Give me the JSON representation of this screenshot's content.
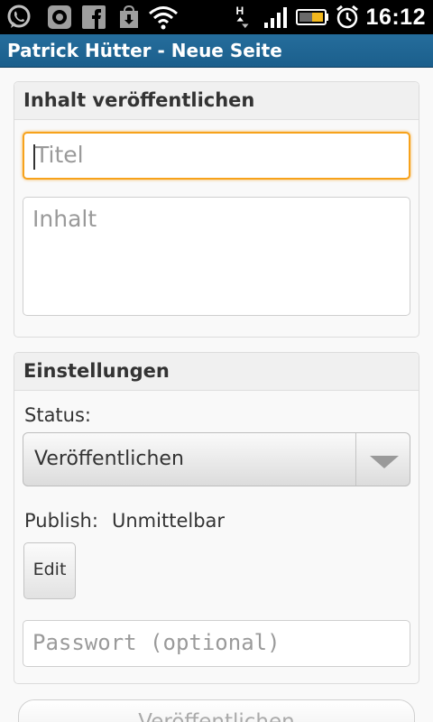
{
  "status_bar": {
    "time": "16:12",
    "icons": [
      "whatsapp-icon",
      "camera-app-icon",
      "facebook-icon",
      "download-icon",
      "wifi-icon",
      "hsdpa-data-icon",
      "signal-icon",
      "battery-icon",
      "alarm-icon"
    ]
  },
  "app_bar": {
    "title": "Patrick Hütter - Neue Seite"
  },
  "content_section": {
    "heading": "Inhalt veröffentlichen",
    "title_placeholder": "Titel",
    "body_placeholder": "Inhalt"
  },
  "settings_section": {
    "heading": "Einstellungen",
    "status_label": "Status:",
    "status_value": "Veröffentlichen",
    "publish_label": "Publish:",
    "publish_value": "Unmittelbar",
    "edit_label": "Edit",
    "password_placeholder": "Passwort (optional)"
  },
  "footer": {
    "publish_button": "Veröffentlichen"
  },
  "colors": {
    "app_bar": "#1f6593",
    "focus_border": "#f7a21b"
  }
}
